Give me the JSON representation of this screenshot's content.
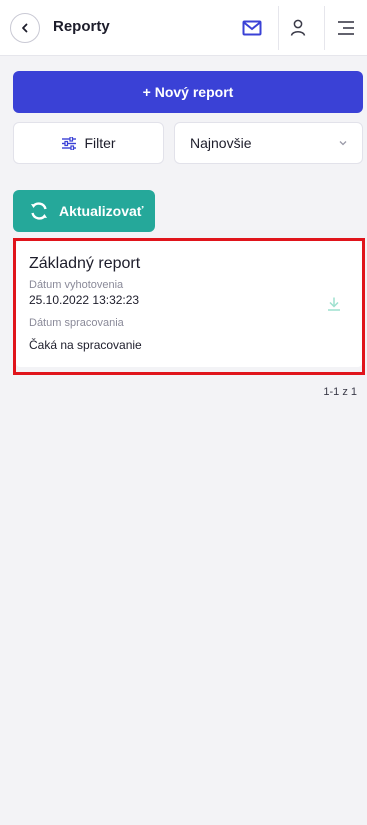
{
  "header": {
    "title": "Reporty",
    "icons": [
      "chevron-left-icon",
      "mail-icon",
      "user-icon",
      "menu-icon"
    ],
    "accent": "#3a41d6"
  },
  "actions": {
    "new_report_label": "+ Nový report",
    "filter_label": "Filter",
    "sort_selected": "Najnovšie",
    "refresh_label": "Aktualizovať"
  },
  "reports": [
    {
      "title": "Základný report",
      "created_label": "Dátum vyhotovenia",
      "created_value": "25.10.2022 13:32:23",
      "processed_label": "Dátum spracovania",
      "status": "Čaká na spracovanie"
    }
  ],
  "pagination": "1-1 z 1",
  "colors": {
    "primary": "#3a41d6",
    "refresh": "#25a89a",
    "highlight": "#e0141b",
    "download_icon": "#9ee0cf"
  }
}
